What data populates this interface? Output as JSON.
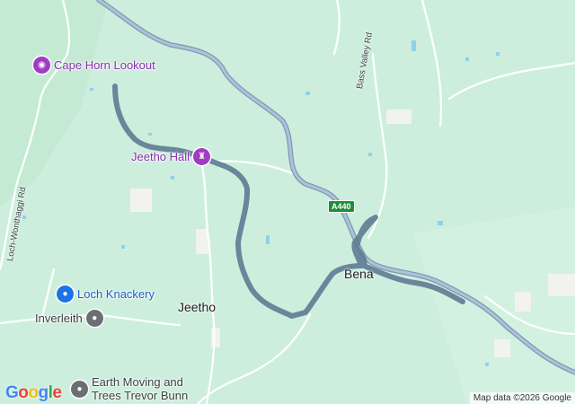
{
  "map": {
    "pois": [
      {
        "name": "Cape Horn Lookout",
        "category": "camera-icon",
        "color": "#a03cc4"
      },
      {
        "name": "Jeetho Hall",
        "category": "museum-icon",
        "color": "#a03cc4"
      },
      {
        "name": "Loch Knackery",
        "category": "lock-icon",
        "color": "#1a73e8"
      },
      {
        "name": "Inverleith",
        "category": "place-icon",
        "color": "#6b6f73"
      },
      {
        "name": "Earth Moving and",
        "name_line2": "Trees Trevor Bunn",
        "category": "place-icon",
        "color": "#6b6f73"
      }
    ],
    "towns": [
      "Jeetho",
      "Bena"
    ],
    "roads": {
      "bass_valley": "Bass Valley Rd",
      "loch_wonthaggi": "Loch-Wonthaggi Rd",
      "highway_shield": "A440"
    },
    "route_color": "#5f7a93",
    "highway_color": "#9fb3c8",
    "land_color": "#cdeedd"
  },
  "logo": {
    "letters": [
      "G",
      "o",
      "o",
      "g",
      "l",
      "e"
    ],
    "colors": [
      "#4285f4",
      "#ea4335",
      "#fbbc05",
      "#4285f4",
      "#34a853",
      "#ea4335"
    ]
  },
  "attribution": "Map data ©2026 Google"
}
